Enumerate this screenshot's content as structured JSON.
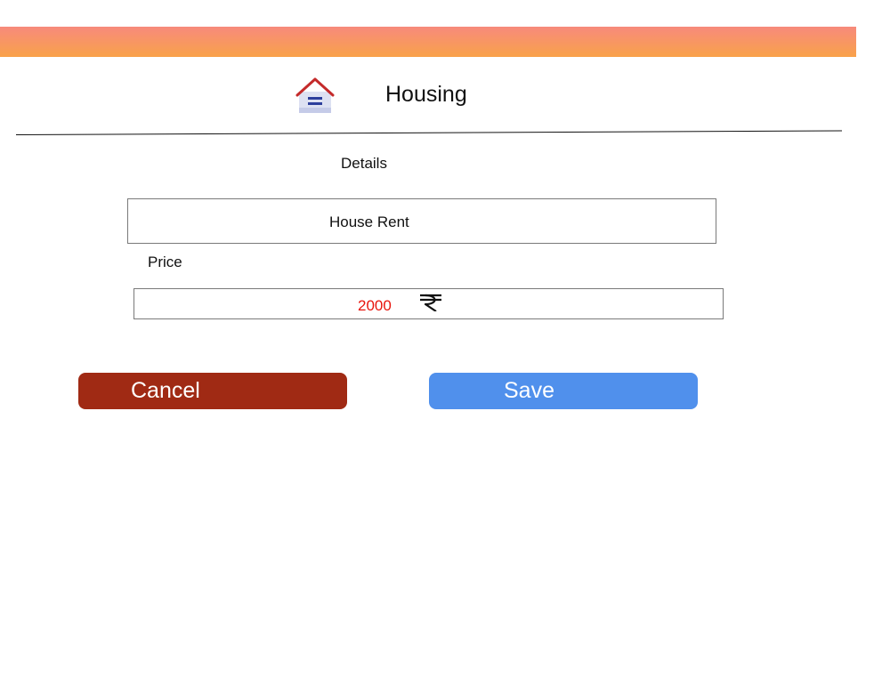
{
  "header": {
    "title": "Housing",
    "icon": "house-icon",
    "banner_gradient": [
      "#f78a7c",
      "#f9a24a"
    ]
  },
  "form": {
    "details_label": "Details",
    "details_value": "House Rent",
    "price_label": "Price",
    "price_value": "2000",
    "price_value_color": "#e8140c",
    "currency_icon": "rupee-icon"
  },
  "actions": {
    "cancel_label": "Cancel",
    "cancel_color": "#a02a14",
    "save_label": "Save",
    "save_color": "#5090ec"
  }
}
